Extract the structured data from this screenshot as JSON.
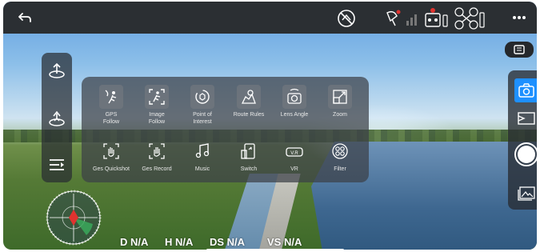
{
  "menu": {
    "items": [
      {
        "label": "GPS\nFollow",
        "icon": "gps-follow-icon"
      },
      {
        "label": "Image\nFollow",
        "icon": "image-follow-icon"
      },
      {
        "label": "Point of\nInterest",
        "icon": "point-of-interest-icon"
      },
      {
        "label": "Route Rules",
        "icon": "route-rules-icon"
      },
      {
        "label": "Lens Angle",
        "icon": "lens-angle-icon"
      },
      {
        "label": "Zoom",
        "icon": "zoom-icon"
      },
      {
        "label": "Ges Quickshot",
        "icon": "gesture-quickshot-icon"
      },
      {
        "label": "Ges Record",
        "icon": "gesture-record-icon"
      },
      {
        "label": "Music",
        "icon": "music-icon"
      },
      {
        "label": "Switch",
        "icon": "switch-icon"
      },
      {
        "label": "VR",
        "icon": "vr-icon"
      },
      {
        "label": "Filter",
        "icon": "filter-icon"
      }
    ]
  },
  "telemetry": {
    "distance": "D N/A",
    "height": "H N/A",
    "horizontal_speed": "DS N/A",
    "vertical_speed": "VS N/A"
  },
  "colors": {
    "topbar": "#2b2f33",
    "accent_blue": "#1e90ff",
    "compass_red": "#e0332f",
    "compass_green": "#3aa85a"
  }
}
